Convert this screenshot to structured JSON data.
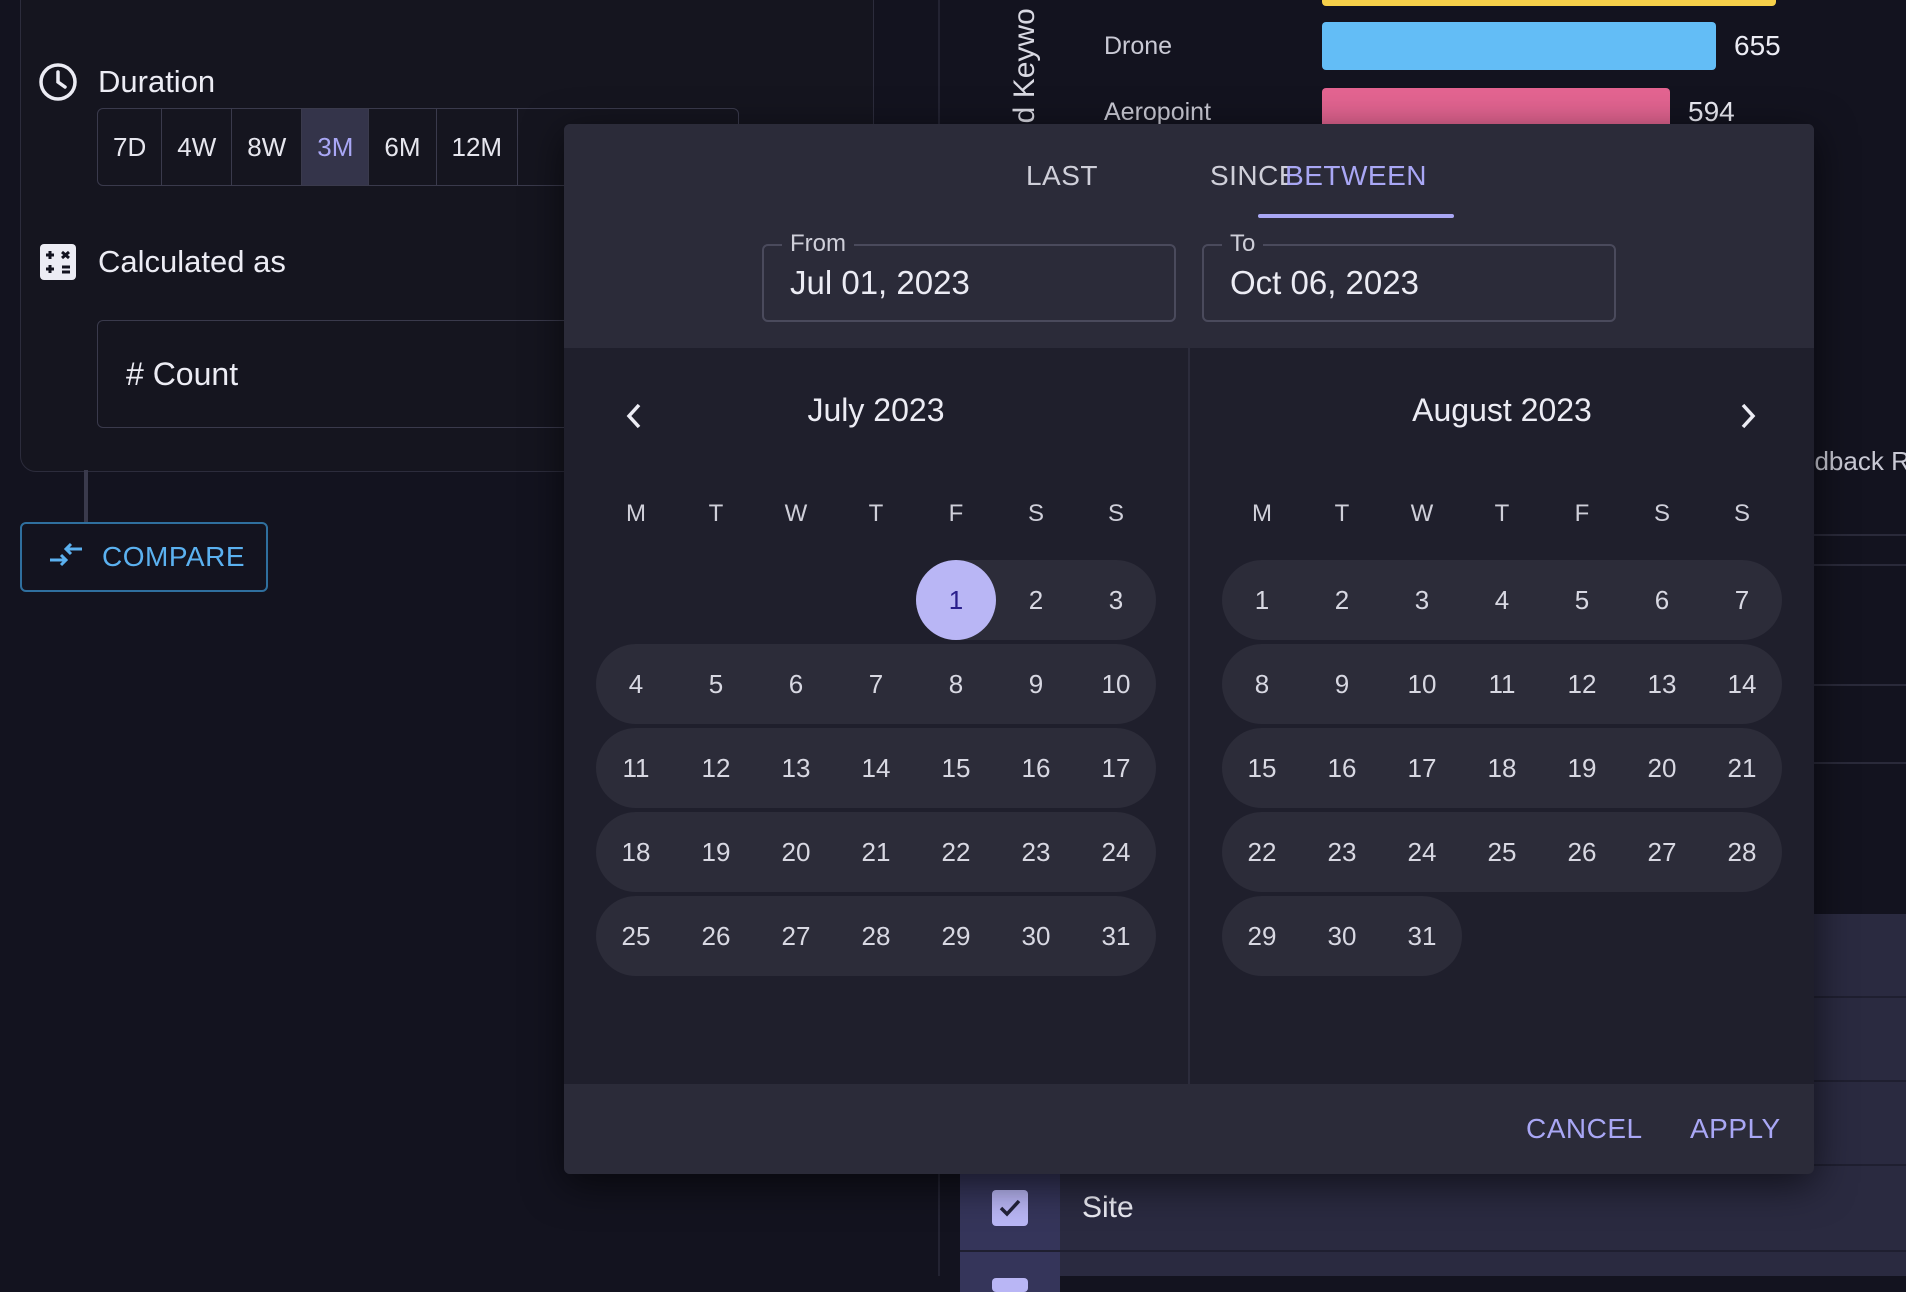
{
  "settings": {
    "duration_label": "Duration",
    "duration_options": [
      "7D",
      "4W",
      "8W",
      "3M",
      "6M",
      "12M"
    ],
    "duration_selected": "3M",
    "calculated_label": "Calculated as",
    "calculated_value": "# Count",
    "compare_label": "COMPARE"
  },
  "background": {
    "axis_title": "ed Keywo",
    "bars": [
      {
        "label": "Drone",
        "value": "655",
        "color": "#63bdf6"
      },
      {
        "label": "Aeropoint",
        "value": "594",
        "color": "#e36491"
      }
    ],
    "top_bar_color": "#f6d04a",
    "feedback_text": "edback R",
    "site_label": "Site"
  },
  "picker": {
    "tabs": [
      "LAST",
      "SINCE",
      "BETWEEN"
    ],
    "active_tab": "BETWEEN",
    "from_label": "From",
    "from_value": "Jul 01, 2023",
    "to_label": "To",
    "to_value": "Oct 06, 2023",
    "weekdays": [
      "M",
      "T",
      "W",
      "T",
      "F",
      "S",
      "S"
    ],
    "months": [
      {
        "title": "July 2023",
        "first_weekday": 5,
        "days": 31
      },
      {
        "title": "August 2023",
        "first_weekday": 1,
        "days": 31
      }
    ],
    "selected_day": "1",
    "cancel_label": "CANCEL",
    "apply_label": "APPLY"
  },
  "colors": {
    "accent": "#a9a7f5",
    "selected_day_bg": "#b9b6f5",
    "compare": "#5bb1f0"
  }
}
